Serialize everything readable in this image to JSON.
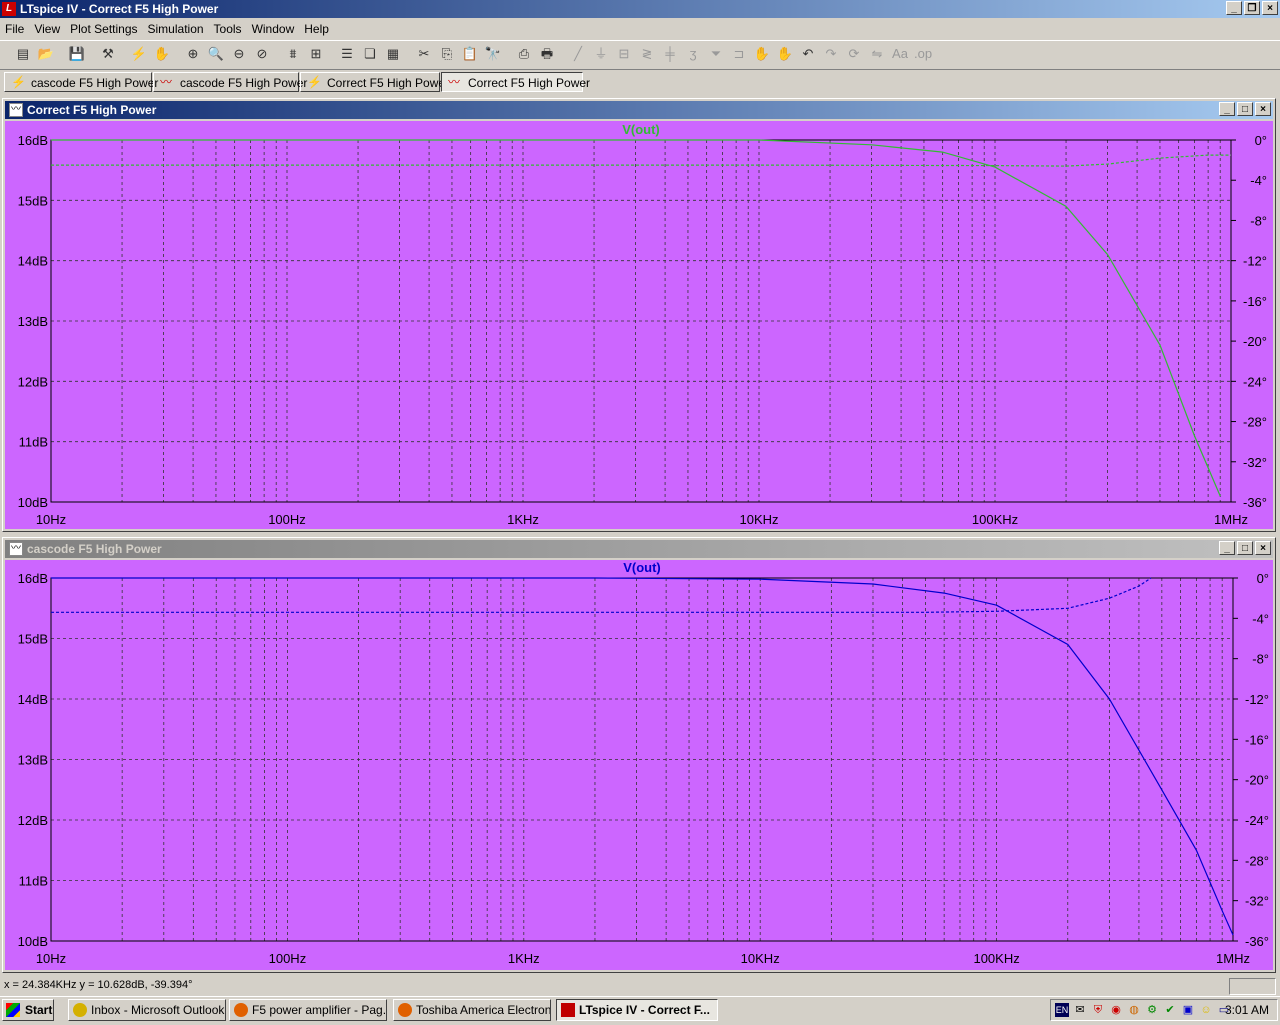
{
  "window": {
    "title": "LTspice IV - Correct F5 High Power",
    "app_icon": "ltspice-icon"
  },
  "menu": [
    "File",
    "View",
    "Plot Settings",
    "Simulation",
    "Tools",
    "Window",
    "Help"
  ],
  "tabs": [
    {
      "label": "cascode F5 High Power",
      "icon": "schematic-icon",
      "active": false
    },
    {
      "label": "cascode F5 High Power",
      "icon": "waveform-icon",
      "active": false
    },
    {
      "label": "Correct F5 High Power",
      "icon": "schematic-icon",
      "active": false
    },
    {
      "label": "Correct F5 High Power",
      "icon": "waveform-icon",
      "active": true
    }
  ],
  "panes": [
    {
      "title": "Correct F5 High Power",
      "active": true,
      "trace_label": "V(out)",
      "trace_color": "#33bb33"
    },
    {
      "title": "cascode F5 High Power",
      "active": false,
      "trace_label": "V(out)",
      "trace_color": "#0000cc"
    }
  ],
  "chart_data": [
    {
      "type": "line",
      "title": "V(out)",
      "x_scale": "log",
      "xlim": [
        10,
        1000000
      ],
      "x_ticks": [
        "10Hz",
        "100Hz",
        "1KHz",
        "10KHz",
        "100KHz",
        "1MHz"
      ],
      "ylim": [
        10,
        16
      ],
      "y_ticks": [
        "16dB",
        "15dB",
        "14dB",
        "13dB",
        "12dB",
        "11dB",
        "10dB"
      ],
      "y2lim": [
        -36,
        0
      ],
      "y2_ticks": [
        "0°",
        "-4°",
        "-8°",
        "-12°",
        "-16°",
        "-20°",
        "-24°",
        "-28°",
        "-32°",
        "-36°"
      ],
      "grid": true,
      "series": [
        {
          "name": "V(out)",
          "kind": "magnitude-dB",
          "x": [
            10,
            1000,
            10000,
            30000,
            60000,
            100000,
            200000,
            300000,
            500000,
            700000,
            900000
          ],
          "y": [
            16.0,
            16.0,
            16.0,
            15.92,
            15.8,
            15.55,
            14.9,
            14.1,
            12.6,
            11.1,
            10.1
          ]
        },
        {
          "name": "V(out)",
          "kind": "phase-deg",
          "x": [
            10,
            1000,
            10000,
            100000,
            200000,
            300000,
            500000,
            800000,
            1000000
          ],
          "y": [
            -2.5,
            -2.5,
            -2.5,
            -2.55,
            -2.6,
            -2.4,
            -1.8,
            -1.5,
            -1.5
          ]
        }
      ]
    },
    {
      "type": "line",
      "title": "V(out)",
      "x_scale": "log",
      "xlim": [
        10,
        1000000
      ],
      "x_ticks": [
        "10Hz",
        "100Hz",
        "1KHz",
        "10KHz",
        "100KHz",
        "1MHz"
      ],
      "ylim": [
        10,
        16
      ],
      "y_ticks": [
        "16dB",
        "15dB",
        "14dB",
        "13dB",
        "12dB",
        "11dB",
        "10dB"
      ],
      "y2lim": [
        -36,
        0
      ],
      "y2_ticks": [
        "0°",
        "-4°",
        "-8°",
        "-12°",
        "-16°",
        "-20°",
        "-24°",
        "-28°",
        "-32°",
        "-36°"
      ],
      "grid": true,
      "series": [
        {
          "name": "V(out)",
          "kind": "phase-deg",
          "x": [
            10,
            1000,
            10000,
            50000,
            100000,
            200000,
            300000,
            400000,
            450000
          ],
          "y": [
            -3.4,
            -3.4,
            -3.4,
            -3.4,
            -3.3,
            -3.0,
            -2.0,
            -0.8,
            0
          ]
        },
        {
          "name": "V(out)",
          "kind": "magnitude-dB",
          "x": [
            10,
            2000,
            10000,
            30000,
            60000,
            100000,
            200000,
            300000,
            500000,
            700000,
            900000,
            1000000
          ],
          "y": [
            16.0,
            16.0,
            15.98,
            15.9,
            15.75,
            15.55,
            14.9,
            14.0,
            12.5,
            11.5,
            10.5,
            10.1
          ]
        }
      ]
    }
  ],
  "status": {
    "text": "x = 24.384KHz    y = 10.628dB, -39.394°"
  },
  "taskbar": {
    "start_label": "Start",
    "buttons": [
      {
        "label": "Inbox - Microsoft Outlook",
        "color": "#d4b000",
        "active": false
      },
      {
        "label": "F5 power amplifier - Pag...",
        "color": "#e06000",
        "active": false
      },
      {
        "label": "Toshiba America Electron...",
        "color": "#e06000",
        "active": false
      },
      {
        "label": "LTspice IV - Correct F...",
        "color": "#c00000",
        "active": true
      }
    ],
    "clock": "3:01 AM"
  }
}
